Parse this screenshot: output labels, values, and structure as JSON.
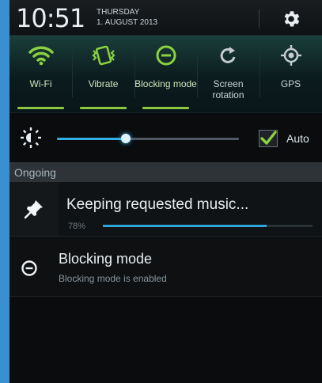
{
  "header": {
    "time": "10:51",
    "weekday": "THURSDAY",
    "date": "1. AUGUST 2013",
    "settings_icon": "gear-icon"
  },
  "quick_settings": [
    {
      "label": "Wi-Fi",
      "icon": "wifi-icon",
      "on": true
    },
    {
      "label": "Vibrate",
      "icon": "vibrate-icon",
      "on": true
    },
    {
      "label": "Blocking mode",
      "icon": "blocking-mode-icon",
      "on": true
    },
    {
      "label": "Screen rotation",
      "icon": "screen-rotation-icon",
      "on": false
    },
    {
      "label": "GPS",
      "icon": "gps-icon",
      "on": false
    }
  ],
  "brightness": {
    "level": 0.38,
    "auto_label": "Auto",
    "auto_checked": true,
    "accent": "#33b0e6"
  },
  "ongoing": {
    "section_title": "Ongoing",
    "music": {
      "title": "Keeping requested music...",
      "progress_text": "78%",
      "progress": 0.78
    },
    "blocking": {
      "title": "Blocking mode",
      "subtitle": "Blocking mode is enabled"
    }
  },
  "colors": {
    "on_indicator": "#8cc63f",
    "progress": "#2ea8da",
    "background": "#0b0d0f"
  }
}
